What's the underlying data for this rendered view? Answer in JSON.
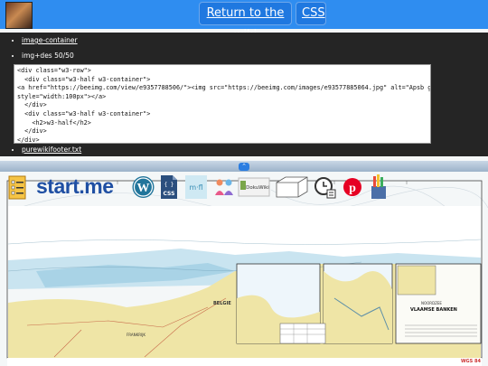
{
  "header": {
    "return_label": "Return to the wiki",
    "css_label": "CSS"
  },
  "panel": {
    "item1": "image-container",
    "item2": "img+des 50/50",
    "item3": "purewikifooter.txt",
    "code": "<div class=\"w3-row\">\n  <div class=\"w3-half w3-container\">\n<a href=\"https://beeimg.com/view/e9357788506/\"><img src=\"https://beeimg.com/images/e93577885064.jpg\" alt=\"Apsb geluidsseinen\"\nstyle=\"width:100px\"></a>\n  </div>\n  <div class=\"w3-half w3-container\">\n    <h2>w3-half</h2>\n  </div>\n</div>"
  },
  "toolbar": {
    "icons": [
      "checklist-icon",
      "startme-logo",
      "wordpress-icon",
      "css-file-icon",
      "mrfl-icon",
      "people-icon",
      "dokuwiki-icon",
      "box-3d-icon",
      "clock-list-icon",
      "pinterest-icon",
      "pencil-cup-icon"
    ],
    "startme_text": "start.me",
    "css_text": "CSS",
    "dokuwiki_text": "DokuWiki"
  },
  "map": {
    "label_belgie": "BELGIE",
    "label_fransen": "FRANKRIJK",
    "inset_title": "VLAAMSE BANKEN",
    "inset_sub": "NOORDZEE",
    "wgs_label": "WGS 84"
  },
  "colors": {
    "topbar": "#2f8df0",
    "land": "#efe5a6",
    "shallow": "#bfe0ee",
    "sea": "#ffffff"
  }
}
